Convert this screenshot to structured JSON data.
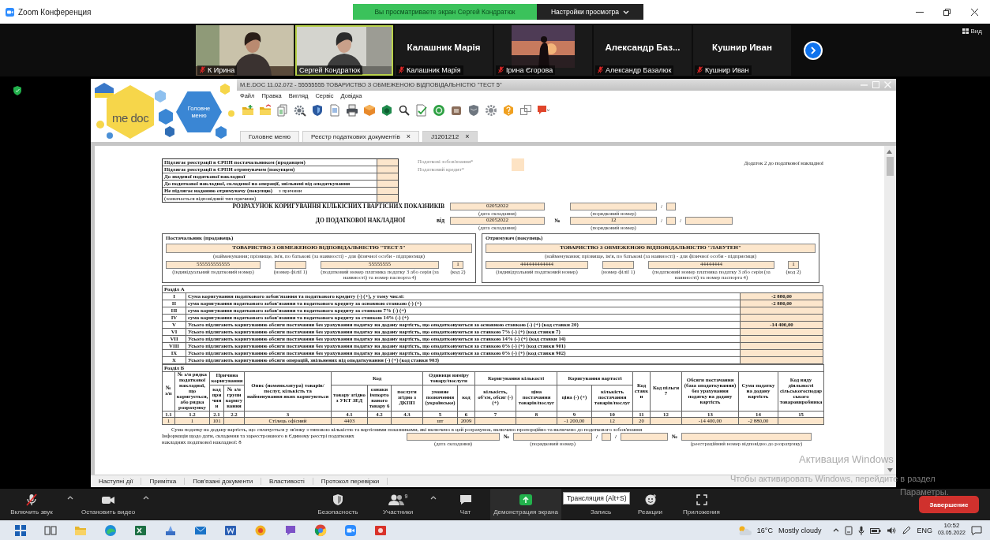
{
  "window": {
    "title": "Zoom Конференция",
    "share_banner": "Вы просматриваете экран Сергей Кондратюк",
    "view_options": "Настройки просмотра"
  },
  "participants": [
    {
      "name": "К Ирина",
      "kind": "video",
      "muted": true,
      "speaking": false
    },
    {
      "name": "Сергей Кондратюк",
      "kind": "video",
      "muted": false,
      "speaking": true
    },
    {
      "name": "Калашник Марія",
      "title": "Калашник Марія",
      "kind": "name",
      "muted": true,
      "speaking": false
    },
    {
      "name": "Ірина Єгорова",
      "kind": "avatar",
      "muted": true,
      "speaking": false
    },
    {
      "name": "Александр Базалюк",
      "title": "Александр Баз...",
      "kind": "name",
      "muted": true,
      "speaking": false
    },
    {
      "name": "Кушнир Иван",
      "title": "Кушнир Иван",
      "kind": "name",
      "muted": true,
      "speaking": false
    }
  ],
  "view_button": "Вид",
  "medoc": {
    "title": "M.E.DOC 11.02.072 - 55555555 ТОВАРИСТВО З ОБМЕЖЕНОЮ ВІДПОВІДАЛЬНІСТЮ \"ТЕСТ 5\"",
    "logo_text": "me doc",
    "logo_badge": "Головне меню",
    "menu": [
      "Файл",
      "Правка",
      "Вигляд",
      "Сервіс",
      "Довідка"
    ],
    "tabs": [
      {
        "label": "Головне меню",
        "selected": false
      },
      {
        "label": "Реєстр податкових документів",
        "close": "×",
        "selected": false
      },
      {
        "label": "J1201212",
        "close": "×",
        "selected": true
      }
    ],
    "bottom_tabs": [
      "Наступні дії",
      "Примітка",
      "Пов'язані документи",
      "Властивості",
      "Протокол перевірки"
    ],
    "form": {
      "checks": [
        {
          "kind": "check",
          "label": "Підлягає реєстрації в ЄРПН постачальником (продавцем)"
        },
        {
          "kind": "check",
          "label": "Підлягає реєстрації в ЄРПН отримувачем (покупцем)"
        },
        {
          "kind": "check",
          "label": "До зведеної податкової накладної"
        },
        {
          "kind": "check",
          "label": "До податкової накладної, складеної на операції, звільнені від оподаткування"
        },
        {
          "kind": "check",
          "label": "Не підлягає наданню отримувачу (покупцю)",
          "extra": "з причини"
        },
        {
          "kind": "note",
          "label": "(зазначається відповідний тип причини)"
        }
      ],
      "tax_labels": [
        "Податкові зобов'язання*",
        "Податковий кредит*"
      ],
      "annex": "Додаток 2 до податкової накладної",
      "title_lines": [
        "РОЗРАХУНОК КОРИГУВАННЯ КІЛЬКІСНИХ І ВАРТІСНИХ ПОКАЗНИКІВ",
        "ДО ПОДАТКОВОЇ НАКЛАДНОЇ"
      ],
      "from_label": "від",
      "number_label": "№",
      "slash": "/",
      "calc": {
        "date": "02052022",
        "date_caption": "(дата складання)",
        "number_caption": "(порядковий номер)"
      },
      "invoice": {
        "date": "02052022",
        "date_caption": "(дата складання)",
        "number": "12",
        "number_caption": "(порядковий номер)"
      },
      "parties": [
        {
          "heading": "Постачальник (продавець)",
          "name": "ТОВАРИСТВО З ОБМЕЖЕНОЮ ВІДПОВІДАЛЬНІСТЮ \"ТЕСТ 5\"",
          "name_caption": "(найменування; прізвище, ім'я, по батькові (за наявності) - для фізичної особи - підприємця)",
          "ipn": "555555555555",
          "ipn_caption": "(індивідуальний податковий номер)",
          "branch_caption": "(номер філії 1)",
          "code": "55555555",
          "code_caption": "(податковий номер платника податку 3 або серія (за наявності) та номер паспорта 4)",
          "type_code": "1",
          "type_caption": "(код 2)"
        },
        {
          "heading": "Отримувач (покупець)",
          "name": "ТОВАРИСТВО З ОБМЕЖЕНОЮ ВІДПОВІДАЛЬНІСТЮ \"ЛАБУТЕН\"",
          "name_caption": "(найменування; прізвище, ім'я, по батькові (за наявності) - для фізичної особи - підприємця)",
          "ipn": "444444444444",
          "ipn_caption": "(індивідуальний податковий номер)",
          "branch_caption": "(номер філії 1)",
          "code": "44444444",
          "code_caption": "(податковий номер платника податку 3 або серія (за наявності) та номер паспорта 4)",
          "type_code": "1",
          "type_caption": "(код 2)"
        }
      ],
      "section_a": {
        "heading": "Розділ А",
        "rows": [
          {
            "numeral": "I",
            "text": "Сума коригування податкового зобов'язання та податкового кредиту (-) (+), у тому числі:",
            "value": "-2 880,00"
          },
          {
            "numeral": "II",
            "text": "сума коригування податкового зобов'язання та податкового кредиту за основною ставкою (-) (+)",
            "value": "-2 880,00"
          },
          {
            "numeral": "III",
            "text": "сума коригування податкового зобов'язання та податкового кредиту за ставкою 7% (-) (+)"
          },
          {
            "numeral": "IV",
            "text": "сума коригування податкового зобов'язання та податкового кредиту за ставкою 14% (-) (+)"
          },
          {
            "numeral": "V",
            "text": "Усього підлягають коригуванню обсяги постачання без урахування податку на додану вартість, що оподатковуються за основною ставкою (-) (+) (код ставки 20)",
            "value": "-14 400,00"
          },
          {
            "numeral": "VI",
            "text": "Усього підлягають коригуванню обсяги постачання без урахування податку на додану вартість, що оподатковуються за ставкою 7% (-) (+) (код ставки 7)"
          },
          {
            "numeral": "VII",
            "text": "Усього підлягають коригуванню обсяги постачання без урахування податку на додану вартість, що оподатковуються за ставкою 14% (-) (+) (код ставки 14)"
          },
          {
            "numeral": "VIII",
            "text": "Усього підлягають коригуванню обсяги постачання без урахування податку на додану вартість, що оподатковуються за ставкою 0% (-) (+) (код ставки 901)"
          },
          {
            "numeral": "IX",
            "text": "Усього підлягають коригуванню обсяги постачання без урахування податку на додану вартість, що оподатковуються за ставкою 0% (-) (+) (код ставки 902)"
          },
          {
            "numeral": "X",
            "text": "Усього підлягають коригуванню обсяги операцій, звільнених від оподаткування (-) (+) (код ставки 903)"
          }
        ]
      },
      "section_b": {
        "heading": "Розділ Б",
        "columns": [
          {
            "number": "1.1",
            "label": "№ з/п"
          },
          {
            "number": "1.2",
            "label": "№ з/п рядка податкової накладної, що коригується, або рядка розрахунку"
          },
          {
            "label": "Причина коригування",
            "children": [
              {
                "number": "2.1",
                "label": "код причини"
              },
              {
                "number": "2.2",
                "label": "№ з/п групи коригування"
              }
            ]
          },
          {
            "number": "3",
            "label": "Опис (номенклатура) товарів/послуг, кількість та найменування яких коригуються"
          },
          {
            "label": "Код",
            "children": [
              {
                "number": "4.1",
                "label": "товару згідно з УКТ ЗЕД"
              },
              {
                "number": "4.2",
                "label": "ознаки імпортованого товару 6"
              },
              {
                "number": "4.3",
                "label": "послуги згідно з ДКПП"
              }
            ]
          },
          {
            "label": "Одиниця виміру товару/послуги",
            "children": [
              {
                "number": "5",
                "label": "умовне позначення (українське)"
              },
              {
                "number": "6",
                "label": "код"
              }
            ]
          },
          {
            "label": "Коригування кількості",
            "children": [
              {
                "number": "7",
                "label": "кількість, об'єм, обсяг (-) (+)"
              },
              {
                "number": "8",
                "label": "ціна постачання товарів/послуг"
              }
            ]
          },
          {
            "label": "Коригування вартості",
            "children": [
              {
                "number": "9",
                "label": "ціна (-) (+)"
              },
              {
                "number": "10",
                "label": "кількість постачання товарів/послуг"
              }
            ]
          },
          {
            "number": "11",
            "label": "Код ставки"
          },
          {
            "number": "12",
            "label": "Код пільги 7"
          },
          {
            "number": "13",
            "label": "Обсяги постачання (база оподаткування) без урахування податку на додану вартість"
          },
          {
            "number": "14",
            "label": "Сума податку на додану вартість"
          },
          {
            "number": "15",
            "label": "Код виду діяльності сільськогосподарського товаровиробника"
          }
        ],
        "rows": [
          {
            "1.1": "1",
            "1.2": "1",
            "2.1": "101",
            "3": "Стілець офісний",
            "4.1": "4403",
            "5": "шт",
            "6": "2009",
            "9": "-1 200,00",
            "10": "12",
            "11": "20",
            "13": "-14 400,00",
            "14": "-2 880,00"
          }
        ]
      },
      "footer": {
        "note": "Сума податку на додану вартість, що сплачується у зв'язку з типовою кількістю та вартісними показниками, які включено в цей розрахунок, включено пропорційно та включено до податкового зобов'язання",
        "info": "Інформація щодо дати, складення та зареєстрованого в Єдиному реєстрі податкових накладних податкової накладної: 8",
        "number_label": "№",
        "slash": "/",
        "date_caption": "(дата складання)",
        "number_caption": "(порядковий номер)",
        "reg_caption": "(реєстраційний номер відповідно до розрахунку)"
      }
    }
  },
  "meeting_controls": {
    "left": [
      {
        "label": "Включить звук",
        "kind": "mic",
        "muted": true
      },
      {
        "label": "Остановить видео",
        "kind": "camera",
        "muted": false
      }
    ],
    "center": [
      {
        "label": "Безопасность",
        "kind": "security",
        "active": false
      },
      {
        "label": "Участники",
        "kind": "participants",
        "count": "9",
        "active": false
      },
      {
        "label": "Чат",
        "kind": "chat",
        "active": false
      },
      {
        "label": "Демонстрация экрана",
        "kind": "share",
        "active": true
      },
      {
        "label": "Запись",
        "kind": "record",
        "active": false
      },
      {
        "label": "Реакции",
        "kind": "reactions",
        "active": false
      },
      {
        "label": "Приложения",
        "kind": "apps",
        "active": false
      }
    ],
    "tooltip": "Трансляция (Alt+S)",
    "end": "Завершение"
  },
  "watermark": [
    "Активация Windows",
    "Чтобы активировать Windows, перейдите в раздел",
    "Параметры."
  ],
  "taskbar": {
    "temperature": "16°C",
    "weather": "Mostly cloudy",
    "language": "ENG",
    "time": "10:52",
    "date": "03.05.2022"
  }
}
